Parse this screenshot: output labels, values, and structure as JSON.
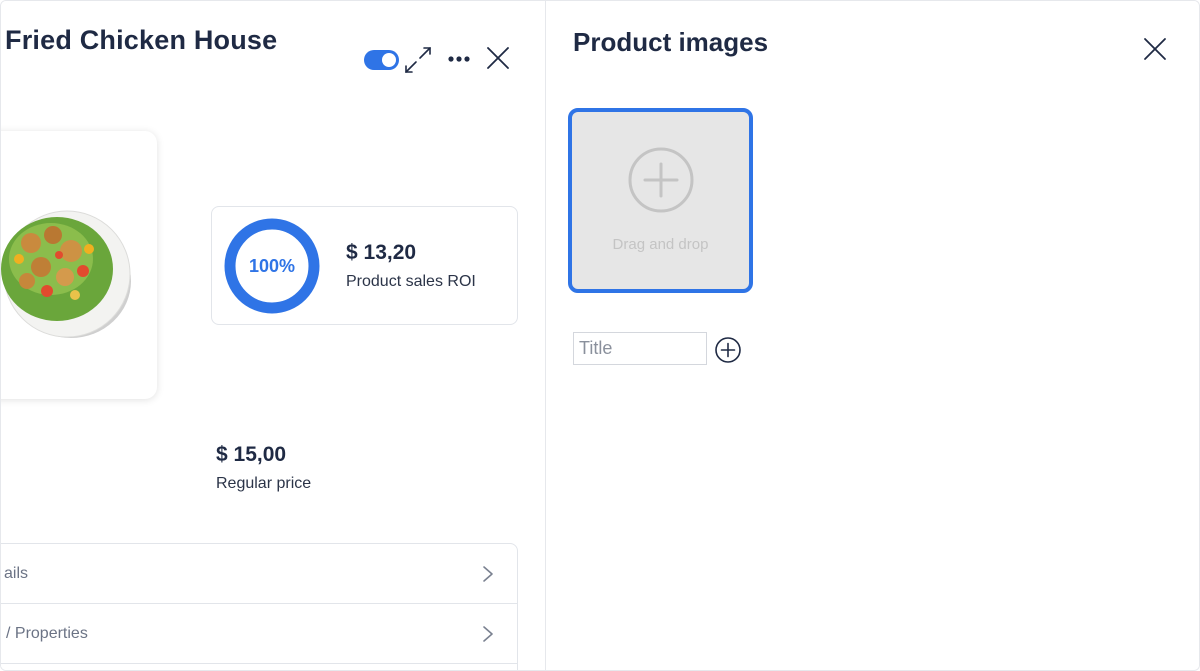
{
  "product": {
    "title": "Fried Chicken House",
    "published_toggle": true
  },
  "icons": {
    "expand": "expand-icon",
    "more": "more-options-icon",
    "close": "close-icon",
    "add": "plus-circle-icon",
    "chevron": "chevron-right-icon"
  },
  "roi": {
    "percent_label": "100%",
    "percent": 100,
    "value": "$ 13,20",
    "label": "Product sales ROI"
  },
  "price": {
    "value": "$ 15,00",
    "label": "Regular price"
  },
  "menu": {
    "items": [
      {
        "label": "ails"
      },
      {
        "label": "/ Properties"
      }
    ]
  },
  "images_panel": {
    "title": "Product images",
    "dropzone_text": "Drag and drop",
    "title_placeholder": "Title"
  },
  "colors": {
    "accent": "#2f74e6",
    "text_dark": "#1f2a44",
    "dropzone_bg": "#e6e6e6"
  }
}
